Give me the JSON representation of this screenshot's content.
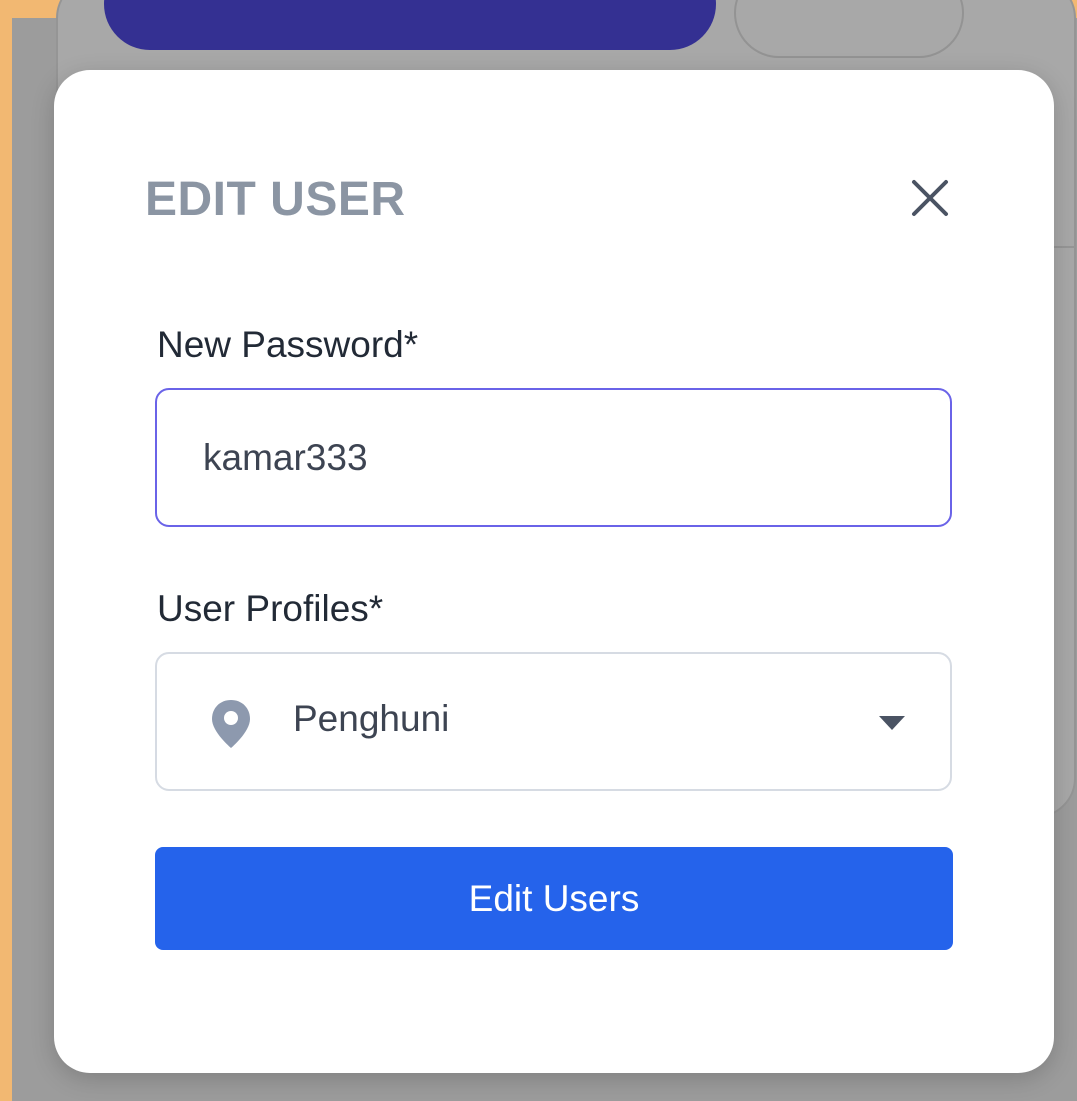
{
  "modal": {
    "title": "EDIT USER",
    "close_icon": "close-icon",
    "password": {
      "label": "New Password*",
      "value": "kamar333"
    },
    "profiles": {
      "label": "User Profiles*",
      "selected": "Penghuni",
      "icon": "map-pin-icon",
      "dropdown_icon": "chevron-down-icon"
    },
    "submit_label": "Edit Users"
  },
  "colors": {
    "accent": "#2563eb",
    "focus_border": "#6a63e8",
    "background_primary_button": "#343092"
  }
}
